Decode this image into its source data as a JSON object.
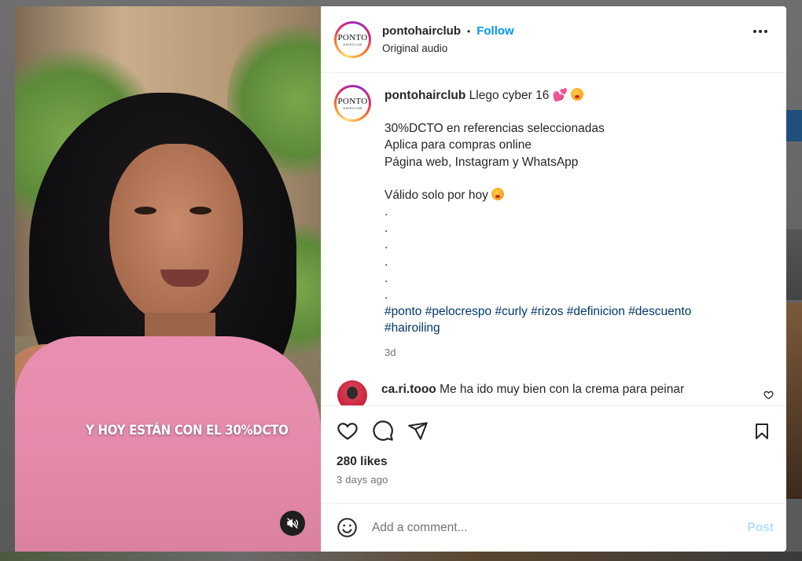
{
  "modal": {
    "video": {
      "caption": "Y HOY ESTÁN CON EL 30%DCTO",
      "mute_icon": "speaker-muted-icon"
    },
    "header": {
      "username": "pontohairclub",
      "separator": "•",
      "follow_label": "Follow",
      "subtitle": "Original audio",
      "avatar_text": "PONTO",
      "avatar_subtext": "HAIRCLUB",
      "more_icon": "more-options-icon"
    },
    "post": {
      "username": "pontohairclub",
      "first_line": " Llego cyber 16 ",
      "lines": [
        "30%DCTO en referencias seleccionadas",
        "Aplica para compras online",
        "Página web, Instagram y WhatsApp"
      ],
      "valid_line": "Válido solo por hoy ",
      "dots": [
        ".",
        ".",
        ".",
        ".",
        ".",
        "."
      ],
      "hashtags_line1": "#ponto #pelocrespo #curly #rizos #definicion #descuento",
      "hashtags_line2": "#hairoiling",
      "time": "3d"
    },
    "comment": {
      "username": "ca.ri.tooo",
      "text": " Me ha ido muy bien con la crema para peinar"
    },
    "likes": "280 likes",
    "time_ago": "3 days ago",
    "add_comment": {
      "placeholder": "Add a comment...",
      "post_label": "Post"
    },
    "colors": {
      "follow": "#0095f6",
      "hashtag": "#00376b",
      "post_disabled": "#b2dffc",
      "muted_text": "#737373"
    }
  }
}
